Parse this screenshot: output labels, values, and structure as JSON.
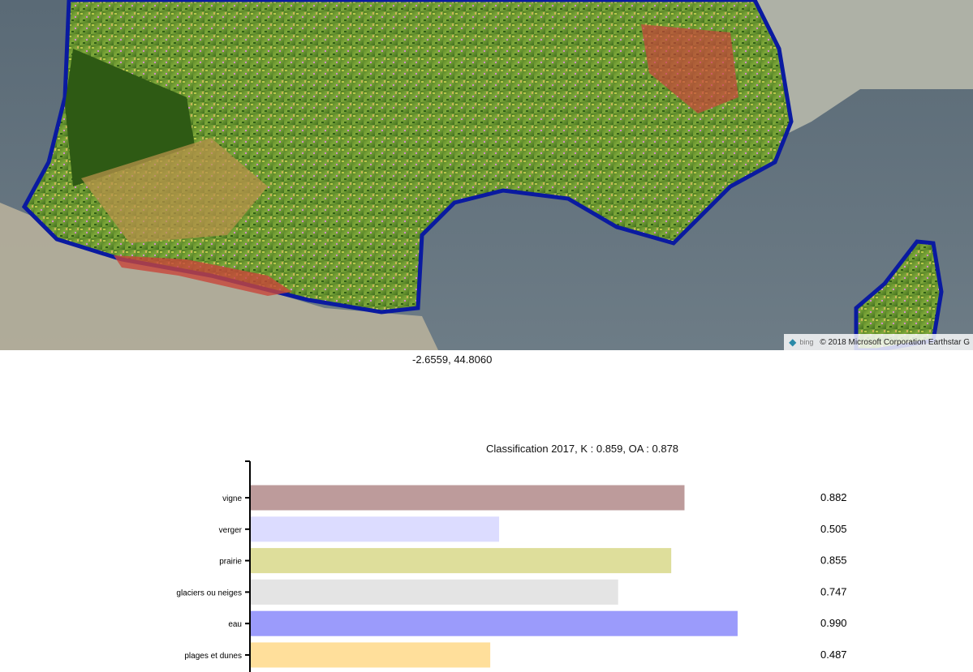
{
  "map": {
    "attribution": {
      "logo_icon": "bing-logo-icon",
      "logo_text": "bing",
      "text": "© 2018 Microsoft Corporation Earthstar G"
    }
  },
  "cursor_coordinates": "-2.6559, 44.8060",
  "chart_data": {
    "type": "bar",
    "orientation": "horizontal",
    "title": "Classification 2017, K : 0.859, OA : 0.878",
    "xlabel": "",
    "ylabel": "",
    "xlim": [
      0,
      1
    ],
    "categories": [
      "vigne",
      "verger",
      "prairie",
      "glaciers ou neiges",
      "eau",
      "plages et dunes"
    ],
    "values": [
      0.882,
      0.505,
      0.855,
      0.747,
      0.99,
      0.487
    ],
    "value_labels": [
      "0.882",
      "0.505",
      "0.855",
      "0.747",
      "0.990",
      "0.487"
    ],
    "colors": [
      "#bd9b9b",
      "#dcdcff",
      "#dede9b",
      "#e4e4e4",
      "#9b9bfb",
      "#ffdf9b"
    ]
  }
}
